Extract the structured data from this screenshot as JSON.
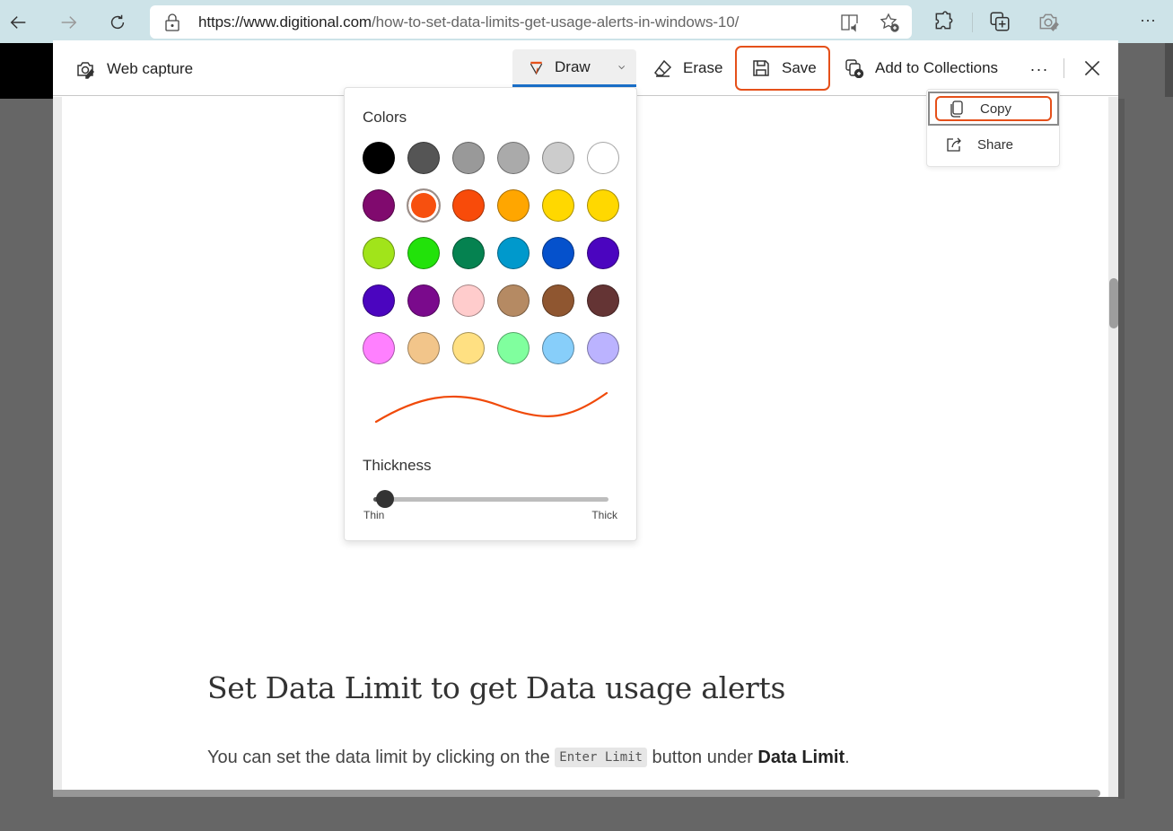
{
  "browser": {
    "url_host": "https://www.digitional.com",
    "url_path": "/how-to-set-data-limits-get-usage-alerts-in-windows-10/",
    "icons": [
      "back-icon",
      "forward-icon",
      "refresh-icon",
      "lock-icon",
      "read-aloud-icon",
      "add-favorite-icon",
      "extensions-icon",
      "collections-icon",
      "web-capture-icon",
      "more-icon"
    ],
    "more_label": "···"
  },
  "capture": {
    "title": "Web capture",
    "tools": {
      "draw": "Draw",
      "erase": "Erase",
      "save": "Save",
      "collections": "Add to Collections",
      "more": "···"
    },
    "share_menu": [
      {
        "label": "Copy",
        "icon": "copy-icon",
        "highlighted": true
      },
      {
        "label": "Share",
        "icon": "share-icon",
        "highlighted": false
      }
    ]
  },
  "draw_panel": {
    "colors_label": "Colors",
    "colors": [
      "#000000",
      "#555555",
      "#999999",
      "#aaaaaa",
      "#cccccc",
      "#ffffff",
      "#800a6e",
      "#f7500f",
      "#f84b0a",
      "#ffa600",
      "#ffd800",
      "#ffd800",
      "#a1e41a",
      "#22e20a",
      "#058250",
      "#0099cc",
      "#0551cc",
      "#4b05bf",
      "#4b05bf",
      "#7a0a8c",
      "#ffcccc",
      "#b58a63",
      "#8f5630",
      "#643434",
      "#ff80ff",
      "#f2c58a",
      "#ffe082",
      "#80ff9e",
      "#87cefa",
      "#bbb3ff"
    ],
    "selected_color_index": 7,
    "stroke_color": "#f04a0a",
    "thickness_label": "Thickness",
    "thickness_min_label": "Thin",
    "thickness_max_label": "Thick",
    "thickness_value": 0.05
  },
  "article": {
    "heading": "Set Data Limit to get Data usage alerts",
    "para_before": "You can set the data limit by clicking on the ",
    "code": "Enter Limit",
    "para_middle": " button under ",
    "para_bold": "Data Limit",
    "para_end": "."
  },
  "accent_color": "#e5501a",
  "draw_underline_color": "#1a6fc9"
}
